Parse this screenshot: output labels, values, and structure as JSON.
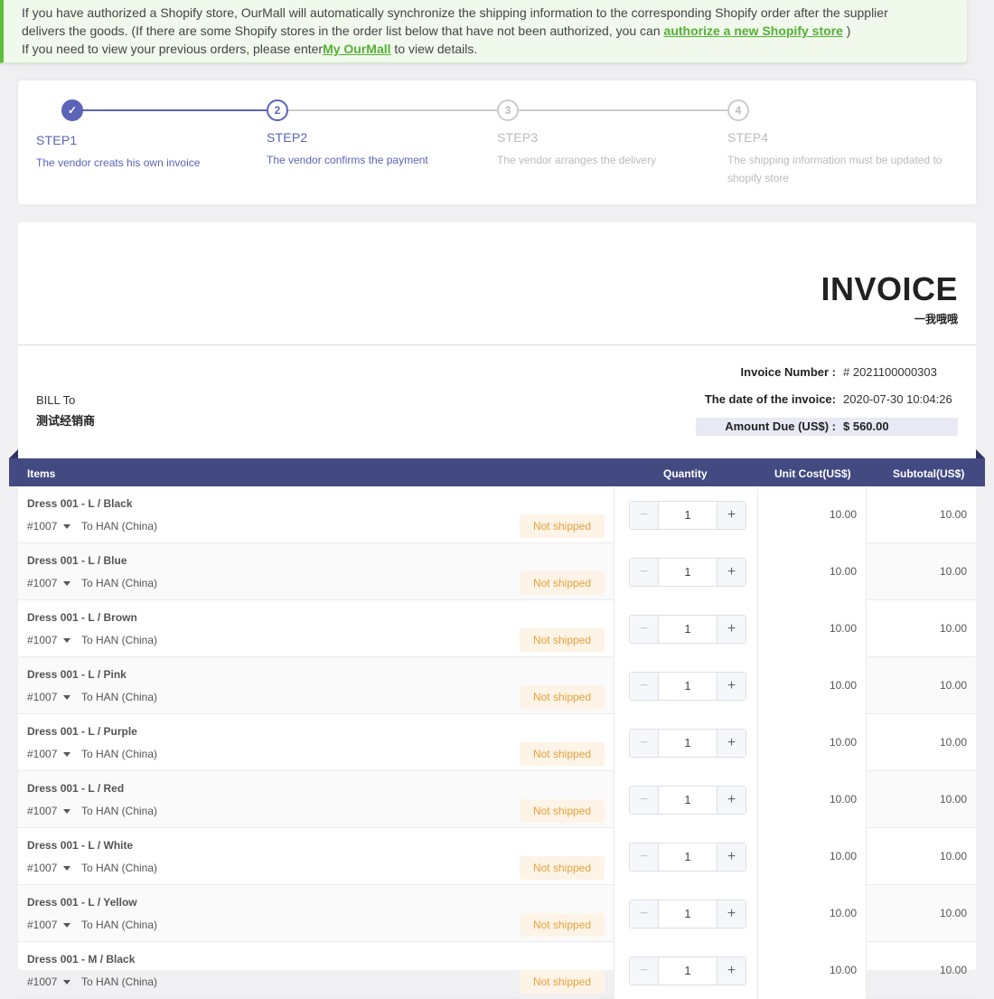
{
  "notice": {
    "line1": "If you have authorized a Shopify store, OurMall will automatically synchronize the shipping information to the corresponding Shopify order after the supplier",
    "line2_pre": "delivers the goods. (If there are some Shopify stores in the order list below that have not been authorized, you can ",
    "line2_link": "authorize a new Shopify store",
    "line2_post": " )",
    "line3_pre": "If you need to view your previous orders, please enter",
    "line3_link": "My OurMall",
    "line3_post": " to view details.",
    "accent": "#5fbf3c"
  },
  "steps": [
    {
      "title": "STEP1",
      "desc": "The vendor creats his own invoice",
      "state": "done",
      "num": "✓"
    },
    {
      "title": "STEP2",
      "desc": "The vendor confirms the payment",
      "state": "active",
      "num": "2"
    },
    {
      "title": "STEP3",
      "desc": "The vendor arranges the delivery",
      "state": "pending",
      "num": "3"
    },
    {
      "title": "STEP4",
      "desc": "The shipping information must be updated to shopify store",
      "state": "pending",
      "num": "4"
    }
  ],
  "invoice": {
    "title": "INVOICE",
    "subtitle": "一我哦哦",
    "bill_to_label": "BILL To",
    "bill_to_name": "测试经销商",
    "number_label": "Invoice Number :",
    "number_value": "# 2021100000303",
    "date_label": "The date of the invoice:",
    "date_value": "2020-07-30 10:04:26",
    "amount_label": "Amount Due (US$) :",
    "amount_value": "$ 560.00"
  },
  "table": {
    "headers": {
      "items": "Items",
      "quantity": "Quantity",
      "unit_cost": "Unit Cost(US$)",
      "subtotal": "Subtotal(US$)"
    },
    "header_color": "#434a82",
    "rows": [
      {
        "name": "Dress 001 - L / Black",
        "order": "#1007",
        "dest": "To HAN (China)",
        "status": "Not shipped",
        "qty": "1",
        "unit": "10.00",
        "subtotal": "10.00"
      },
      {
        "name": "Dress 001 - L / Blue",
        "order": "#1007",
        "dest": "To HAN (China)",
        "status": "Not shipped",
        "qty": "1",
        "unit": "10.00",
        "subtotal": "10.00"
      },
      {
        "name": "Dress 001 - L / Brown",
        "order": "#1007",
        "dest": "To HAN (China)",
        "status": "Not shipped",
        "qty": "1",
        "unit": "10.00",
        "subtotal": "10.00"
      },
      {
        "name": "Dress 001 - L / Pink",
        "order": "#1007",
        "dest": "To HAN (China)",
        "status": "Not shipped",
        "qty": "1",
        "unit": "10.00",
        "subtotal": "10.00"
      },
      {
        "name": "Dress 001 - L / Purple",
        "order": "#1007",
        "dest": "To HAN (China)",
        "status": "Not shipped",
        "qty": "1",
        "unit": "10.00",
        "subtotal": "10.00"
      },
      {
        "name": "Dress 001 - L / Red",
        "order": "#1007",
        "dest": "To HAN (China)",
        "status": "Not shipped",
        "qty": "1",
        "unit": "10.00",
        "subtotal": "10.00"
      },
      {
        "name": "Dress 001 - L / White",
        "order": "#1007",
        "dest": "To HAN (China)",
        "status": "Not shipped",
        "qty": "1",
        "unit": "10.00",
        "subtotal": "10.00"
      },
      {
        "name": "Dress 001 - L / Yellow",
        "order": "#1007",
        "dest": "To HAN (China)",
        "status": "Not shipped",
        "qty": "1",
        "unit": "10.00",
        "subtotal": "10.00"
      },
      {
        "name": "Dress 001 - M / Black",
        "order": "#1007",
        "dest": "To HAN (China)",
        "status": "Not shipped",
        "qty": "1",
        "unit": "10.00",
        "subtotal": "10.00"
      }
    ]
  },
  "stepper": {
    "minus": "−",
    "plus": "+"
  }
}
